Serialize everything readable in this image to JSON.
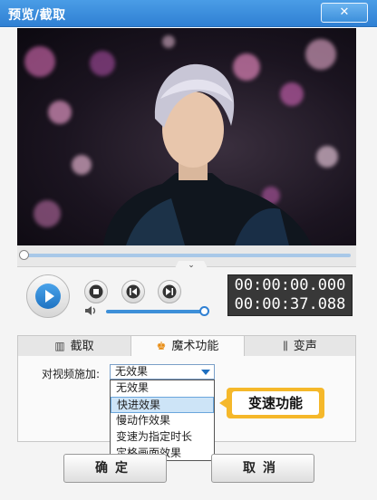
{
  "window": {
    "title": "预览/截取",
    "close_icon": "close-icon"
  },
  "player": {
    "current_time": "00:00:00.000",
    "total_time": "00:00:37.088",
    "icons": [
      "play-icon",
      "stop-icon",
      "previous-icon",
      "next-icon",
      "volume-icon"
    ],
    "accent": "#2f80d3"
  },
  "tabs": [
    {
      "label": "截取",
      "icon": "cut-icon"
    },
    {
      "label": "魔术功能",
      "icon": "magic-hat-icon",
      "active": true
    },
    {
      "label": "变声",
      "icon": "audio-wave-icon"
    }
  ],
  "effect": {
    "label": "对视频施加:",
    "selected": "无效果",
    "options": [
      "无效果",
      "快进效果",
      "慢动作效果",
      "变速为指定时长",
      "定格画面效果"
    ],
    "highlighted": "快进效果"
  },
  "callout": {
    "text": "变速功能",
    "color": "#f5b82a"
  },
  "buttons": {
    "ok": "确定",
    "cancel": "取消"
  }
}
